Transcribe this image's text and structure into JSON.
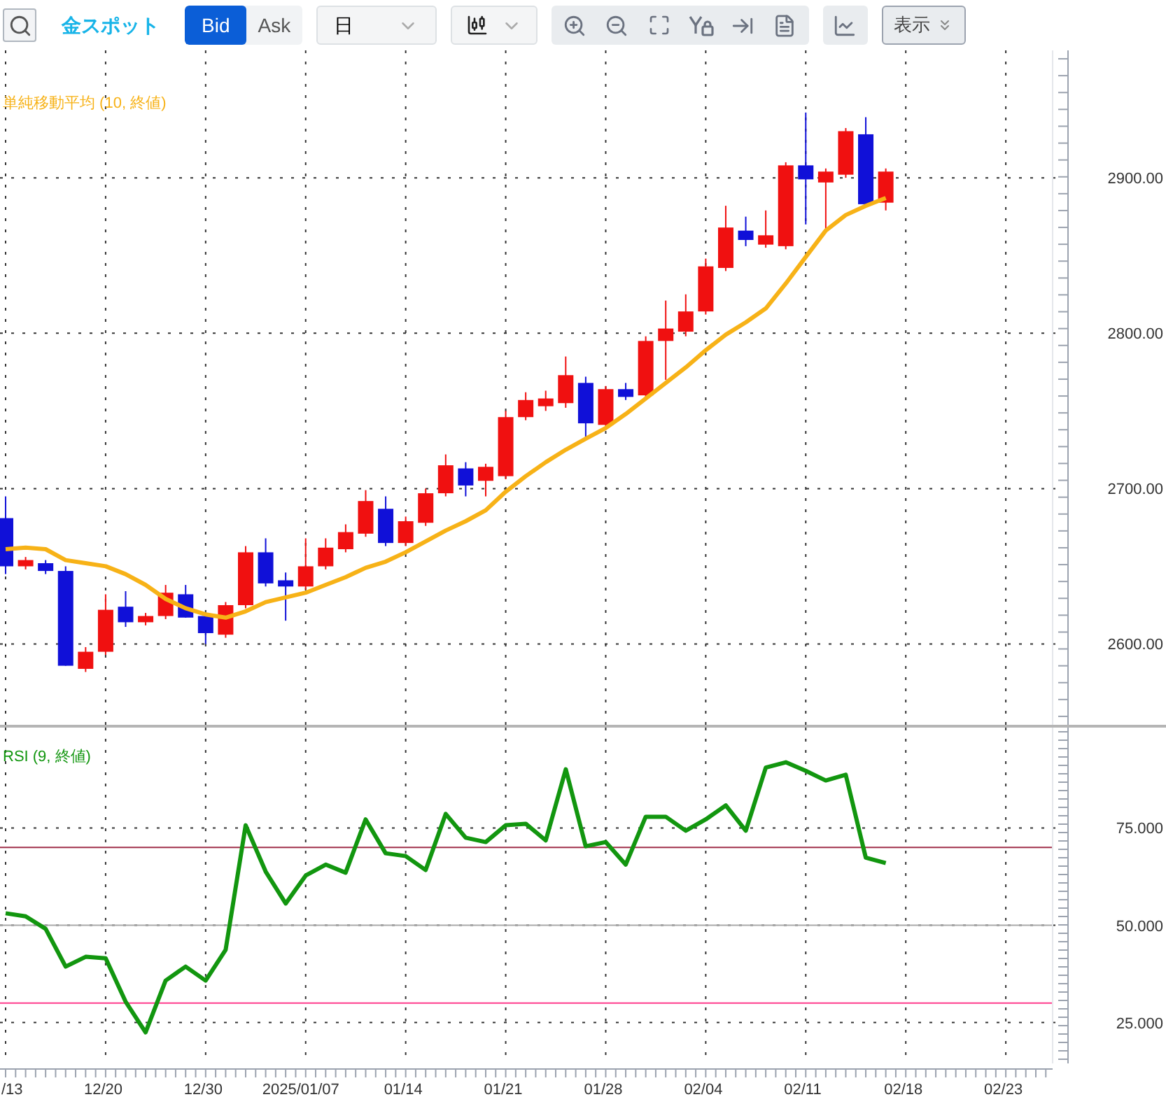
{
  "toolbar": {
    "instrument": "金スポット",
    "price_sides": [
      {
        "label": "Bid",
        "selected": true
      },
      {
        "label": "Ask",
        "selected": false
      }
    ],
    "period": {
      "value": "日"
    },
    "display_button": {
      "label": "表示"
    }
  },
  "main_chart": {
    "chart_data": {
      "type": "candlestick",
      "grid": true,
      "categories": [
        null,
        null,
        null,
        null,
        null,
        null,
        null,
        null,
        null,
        null,
        null,
        null,
        null,
        null,
        null,
        null,
        null,
        null,
        null,
        null,
        null,
        null,
        null,
        null,
        null,
        null,
        null,
        null,
        null,
        null,
        null,
        null,
        null,
        null,
        null,
        null,
        null,
        null,
        null,
        null,
        null,
        null,
        null,
        null,
        null,
        null,
        null,
        null,
        null,
        null,
        null,
        null,
        null
      ],
      "ylim": [
        2548,
        2982
      ],
      "yticks": [
        {
          "value": 2600,
          "label": "2600.00"
        },
        {
          "value": 2700,
          "label": "2700.00"
        },
        {
          "value": 2800,
          "label": "2800.00"
        },
        {
          "value": 2900,
          "label": "2900.00"
        }
      ],
      "ohlc": [
        [
          2681,
          2695,
          2645,
          2650
        ],
        [
          2650,
          2656,
          2648,
          2654
        ],
        [
          2652,
          2654,
          2645,
          2647
        ],
        [
          2647,
          2650,
          2586,
          2586
        ],
        [
          2584,
          2598,
          2582,
          2595
        ],
        [
          2595,
          2632,
          2593,
          2622
        ],
        [
          2624,
          2634,
          2611,
          2614
        ],
        [
          2614,
          2620,
          2612,
          2618
        ],
        [
          2618,
          2638,
          2616,
          2633
        ],
        [
          2632,
          2638,
          2617,
          2617
        ],
        [
          2618,
          2620,
          2600,
          2607
        ],
        [
          2606,
          2627,
          2604,
          2625
        ],
        [
          2625,
          2663,
          2623,
          2659
        ],
        [
          2659,
          2668,
          2637,
          2639
        ],
        [
          2641,
          2646,
          2615,
          2637
        ],
        [
          2637,
          2668,
          2635,
          2650
        ],
        [
          2650,
          2668,
          2648,
          2662
        ],
        [
          2661,
          2677,
          2659,
          2672
        ],
        [
          2671,
          2699,
          2669,
          2692
        ],
        [
          2687,
          2695,
          2663,
          2665
        ],
        [
          2665,
          2682,
          2663,
          2679
        ],
        [
          2678,
          2700,
          2676,
          2697
        ],
        [
          2697,
          2722,
          2695,
          2715
        ],
        [
          2713,
          2717,
          2695,
          2702
        ],
        [
          2705,
          2716,
          2695,
          2714
        ],
        [
          2708,
          2750,
          2706,
          2746
        ],
        [
          2746,
          2762,
          2744,
          2757
        ],
        [
          2753,
          2763,
          2750,
          2758
        ],
        [
          2755,
          2785,
          2752,
          2773
        ],
        [
          2768,
          2772,
          2731,
          2742
        ],
        [
          2741,
          2766,
          2739,
          2764
        ],
        [
          2764,
          2768,
          2757,
          2759
        ],
        [
          2760,
          2798,
          2758,
          2795
        ],
        [
          2795,
          2821,
          2770,
          2803
        ],
        [
          2801,
          2825,
          2798,
          2814
        ],
        [
          2814,
          2848,
          2812,
          2843
        ],
        [
          2842,
          2882,
          2840,
          2868
        ],
        [
          2866,
          2875,
          2856,
          2860
        ],
        [
          2857,
          2879,
          2855,
          2863
        ],
        [
          2856,
          2910,
          2854,
          2908
        ],
        [
          2908,
          2942,
          2870,
          2899
        ],
        [
          2897,
          2906,
          2866,
          2904
        ],
        [
          2902,
          2932,
          2900,
          2930
        ],
        [
          2928,
          2939,
          2881,
          2883
        ],
        [
          2884,
          2906,
          2879,
          2904
        ],
        null,
        null,
        null,
        null,
        null,
        null,
        null,
        null
      ],
      "series": [
        {
          "name": "単純移動平均 (10, 終値)",
          "type": "line",
          "color": "#f7b217",
          "values": [
            2661,
            2662,
            2661,
            2654,
            2652,
            2650,
            2645,
            2638,
            2629,
            2623,
            2619,
            2617,
            2621,
            2627,
            2630,
            2633,
            2638,
            2643,
            2649,
            2653,
            2659,
            2666,
            2673,
            2679,
            2686,
            2698,
            2708,
            2717,
            2725,
            2732,
            2739,
            2748,
            2758,
            2768,
            2778,
            2789,
            2799,
            2807,
            2816,
            2832,
            2849,
            2866,
            2876,
            2882,
            2887,
            null,
            null,
            null,
            null,
            null,
            null,
            null,
            null
          ]
        }
      ]
    }
  },
  "rsi_chart": {
    "chart_data": {
      "type": "line",
      "grid": true,
      "categories": [
        "/13",
        null,
        null,
        null,
        null,
        "12/20",
        null,
        null,
        null,
        null,
        "12/30",
        null,
        null,
        null,
        null,
        "2025/01/07",
        null,
        null,
        null,
        null,
        "01/14",
        null,
        null,
        null,
        null,
        "01/21",
        null,
        null,
        null,
        null,
        "01/28",
        null,
        null,
        null,
        null,
        "02/04",
        null,
        null,
        null,
        null,
        "02/11",
        null,
        null,
        null,
        null,
        "02/18",
        null,
        null,
        null,
        null,
        "02/23",
        null,
        null
      ],
      "ylim": [
        14.5,
        100.8
      ],
      "yticks": [
        {
          "value": 25,
          "label": "25.000"
        },
        {
          "value": 50,
          "label": "50.000"
        },
        {
          "value": 75,
          "label": "75.000"
        }
      ],
      "ref_lines": [
        {
          "axis": "y",
          "value": 70,
          "color": "#a0304a"
        },
        {
          "axis": "y",
          "value": 50,
          "color": "#aaaaaa"
        },
        {
          "axis": "y",
          "value": 30,
          "color": "#ff3c8c"
        }
      ],
      "series": [
        {
          "name": "RSI (9, 終値)",
          "color": "#12960f",
          "values": [
            53.1,
            52.3,
            49.1,
            39.4,
            41.9,
            41.5,
            30.4,
            22.5,
            35.8,
            39.4,
            35.8,
            43.7,
            75.7,
            63.8,
            55.6,
            62.8,
            65.6,
            63.5,
            77.2,
            68.5,
            67.8,
            64.2,
            78.6,
            72.5,
            71.4,
            75.7,
            76.1,
            71.8,
            90.1,
            70.3,
            71.4,
            65.6,
            77.9,
            77.9,
            74.3,
            77.2,
            80.8,
            74.3,
            90.5,
            91.9,
            89.7,
            87.2,
            88.7,
            67.4,
            66.0,
            null,
            null,
            null,
            null,
            null,
            null,
            null,
            null
          ]
        }
      ]
    }
  }
}
